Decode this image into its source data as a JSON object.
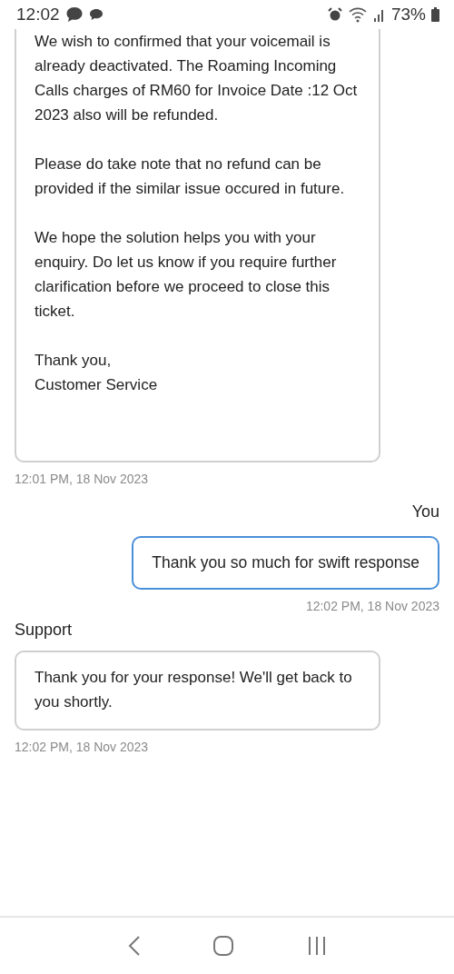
{
  "status_bar": {
    "time": "12:02",
    "battery": "73%"
  },
  "messages": [
    {
      "kind": "incoming",
      "paragraphs": [
        "We wish to confirmed that your voicemail is already deactivated. The Roaming Incoming Calls charges of RM60 for Invoice Date :12 Oct 2023 also will be refunded.",
        "Please do take note that no refund can be provided if the similar issue occured in future.",
        "We hope the solution helps you with your enquiry. Do let us know if you require further clarification before we proceed to close this ticket.",
        "Thank you,\nCustomer Service"
      ],
      "time": "12:01 PM, 18 Nov 2023"
    },
    {
      "kind": "outgoing",
      "sender": "You",
      "paragraphs": [
        "Thank you so much for swift response"
      ],
      "time": "12:02 PM, 18 Nov 2023"
    },
    {
      "kind": "incoming",
      "sender": "Support",
      "paragraphs": [
        "Thank you for your response! We'll get back to you shortly."
      ],
      "time": "12:02 PM, 18 Nov 2023"
    }
  ]
}
